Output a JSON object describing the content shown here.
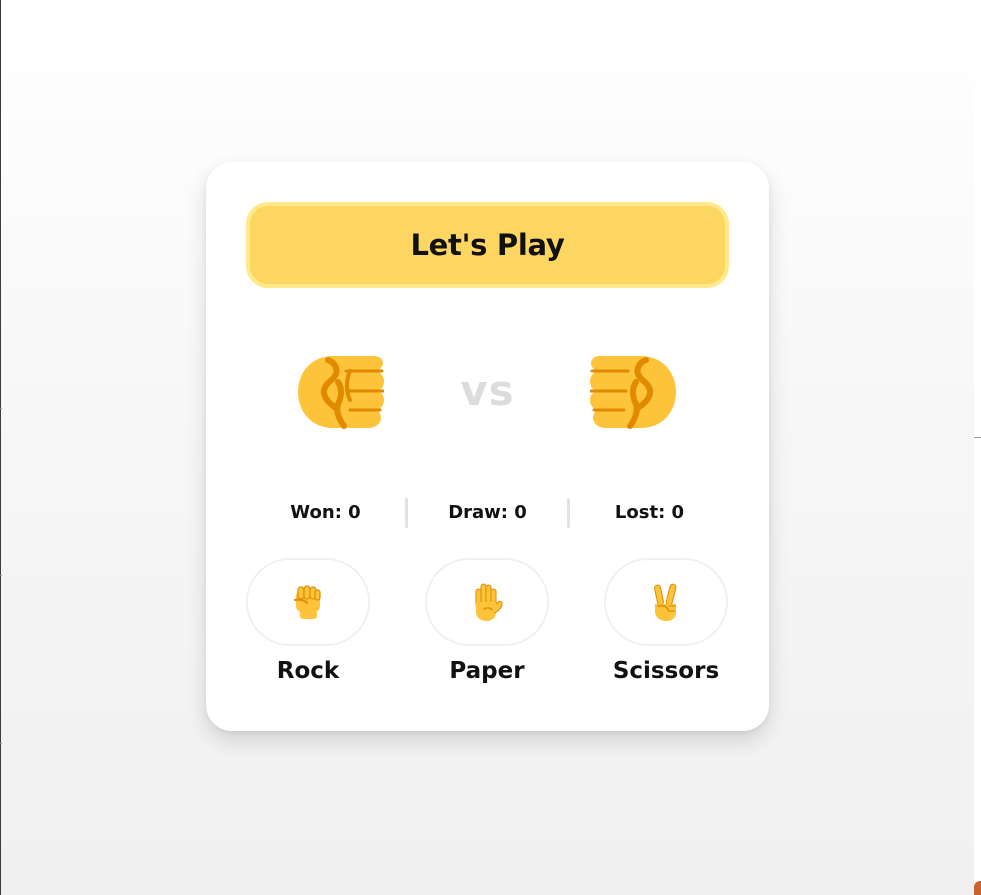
{
  "game": {
    "title": "Let's Play",
    "vs_label": "vs",
    "player_hand_icon": "fist-right-icon",
    "computer_hand_icon": "fist-left-icon",
    "scores": {
      "won": "Won: 0",
      "draw": "Draw: 0",
      "lost": "Lost: 0"
    },
    "choices": [
      {
        "label": "Rock",
        "icon": "raised-fist-icon"
      },
      {
        "label": "Paper",
        "icon": "raised-hand-icon"
      },
      {
        "label": "Scissors",
        "icon": "victory-hand-icon"
      }
    ]
  },
  "colors": {
    "accent": "#fdd561",
    "accent_border": "#ffe98a",
    "emoji_skin": "#fdc33a",
    "emoji_shadow": "#e08a00",
    "vs_text": "#dcdcdc",
    "bottom_accent": "#c8622e"
  }
}
